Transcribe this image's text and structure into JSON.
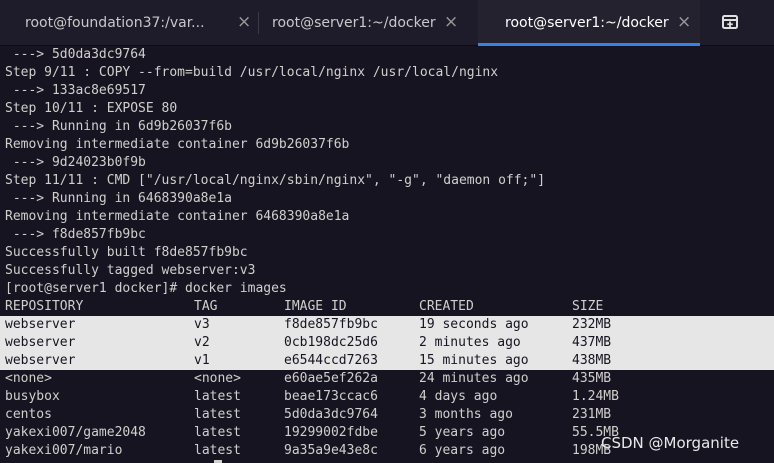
{
  "tabs": [
    {
      "title": "root@foundation37:/var...",
      "close": "×",
      "active": false
    },
    {
      "title": "root@server1:~/docker",
      "close": "×",
      "active": false
    },
    {
      "title": "root@server1:~/docker",
      "close": "×",
      "active": true
    }
  ],
  "new_tab_icon": "new-tab-icon",
  "terminal": {
    "lines": [
      " ---> 5d0da3dc9764",
      "Step 9/11 : COPY --from=build /usr/local/nginx /usr/local/nginx",
      " ---> 133ac8e69517",
      "Step 10/11 : EXPOSE 80",
      " ---> Running in 6d9b26037f6b",
      "Removing intermediate container 6d9b26037f6b",
      " ---> 9d24023b0f9b",
      "Step 11/11 : CMD [\"/usr/local/nginx/sbin/nginx\", \"-g\", \"daemon off;\"]",
      " ---> Running in 6468390a8e1a",
      "Removing intermediate container 6468390a8e1a",
      " ---> f8de857fb9bc",
      "Successfully built f8de857fb9bc",
      "Successfully tagged webserver:v3",
      "[root@server1 docker]# docker images"
    ],
    "table": {
      "headers": [
        "REPOSITORY",
        "TAG",
        "IMAGE ID",
        "CREATED",
        "SIZE"
      ],
      "rows": [
        {
          "repository": "webserver",
          "tag": "v3",
          "image_id": "f8de857fb9bc",
          "created": "19 seconds ago",
          "size": "232MB",
          "selected": true
        },
        {
          "repository": "webserver",
          "tag": "v2",
          "image_id": "0cb198dc25d6",
          "created": "2 minutes ago",
          "size": "437MB",
          "selected": true
        },
        {
          "repository": "webserver",
          "tag": "v1",
          "image_id": "e6544ccd7263",
          "created": "15 minutes ago",
          "size": "438MB",
          "selected": true
        },
        {
          "repository": "<none>",
          "tag": "<none>",
          "image_id": "e60ae5ef262a",
          "created": "24 minutes ago",
          "size": "435MB",
          "selected": false
        },
        {
          "repository": "busybox",
          "tag": "latest",
          "image_id": "beae173ccac6",
          "created": "4 days ago",
          "size": "1.24MB",
          "selected": false
        },
        {
          "repository": "centos",
          "tag": "latest",
          "image_id": "5d0da3dc9764",
          "created": "3 months ago",
          "size": "231MB",
          "selected": false
        },
        {
          "repository": "yakexi007/game2048",
          "tag": "latest",
          "image_id": "19299002fdbe",
          "created": "5 years ago",
          "size": "55.5MB",
          "selected": false
        },
        {
          "repository": "yakexi007/mario",
          "tag": "latest",
          "image_id": "9a35a9e43e8c",
          "created": "6 years ago",
          "size": "198MB",
          "selected": false
        }
      ]
    }
  },
  "watermark": "CSDN @Morganite",
  "colors": {
    "background": "#171421",
    "text": "#d0cfcc",
    "selection": "#e6e6e6",
    "accent": "#3584e4"
  }
}
